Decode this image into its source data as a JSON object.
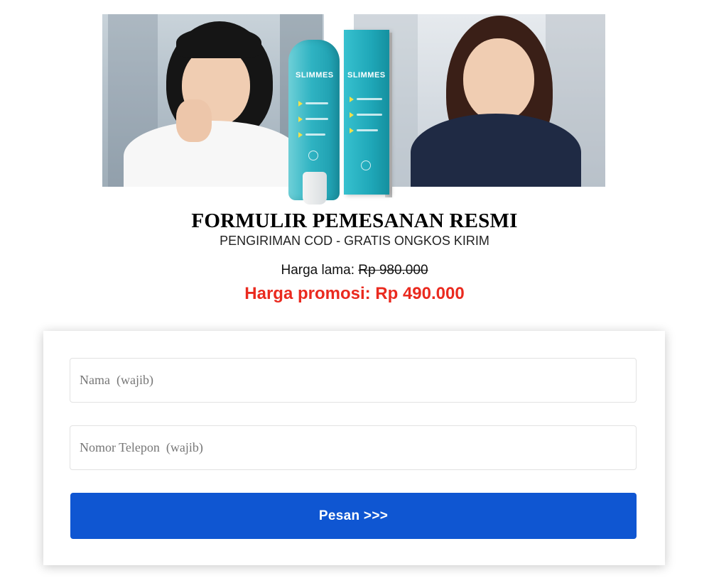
{
  "hero": {
    "product_brand": "SLIMMES"
  },
  "header": {
    "title": "FORMULIR PEMESANAN RESMI",
    "subtitle": "PENGIRIMAN COD - GRATIS ONGKOS KIRIM"
  },
  "pricing": {
    "old_label": "Harga lama:",
    "old_value": "Rp 980.000",
    "promo_text": "Harga promosi: Rp 490.000"
  },
  "form": {
    "name_placeholder": "Nama  (wajib)",
    "phone_placeholder": "Nomor Telepon  (wajib)",
    "submit_label": "Pesan  >>>"
  },
  "colors": {
    "promo": "#ea2a1f",
    "button": "#0f56d2"
  }
}
